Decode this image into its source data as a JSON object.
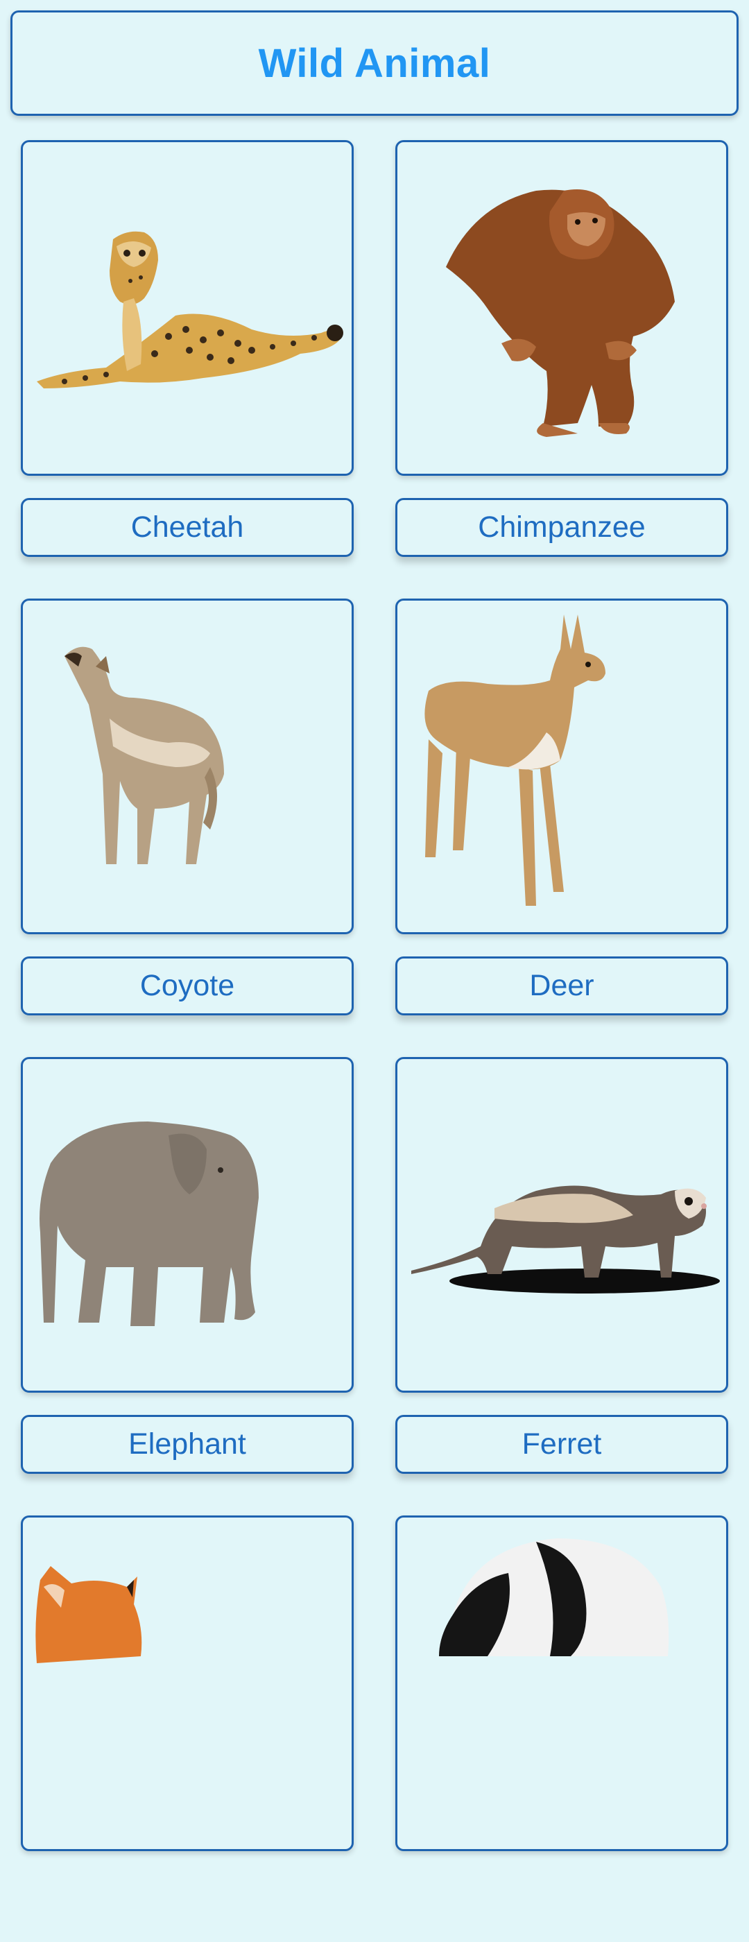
{
  "header": {
    "title": "Wild Animal"
  },
  "animals": [
    {
      "label": "Cheetah",
      "icon": "cheetah-image"
    },
    {
      "label": "Chimpanzee",
      "icon": "chimpanzee-image"
    },
    {
      "label": "Coyote",
      "icon": "coyote-image"
    },
    {
      "label": "Deer",
      "icon": "deer-image"
    },
    {
      "label": "Elephant",
      "icon": "elephant-image"
    },
    {
      "label": "Ferret",
      "icon": "ferret-image"
    },
    {
      "label": "",
      "icon": "fox-image"
    },
    {
      "label": "",
      "icon": "panda-image"
    }
  ],
  "colors": {
    "background": "#e1f6f9",
    "border": "#1e63b0",
    "title": "#2196f3",
    "label": "#1e6cc1"
  }
}
